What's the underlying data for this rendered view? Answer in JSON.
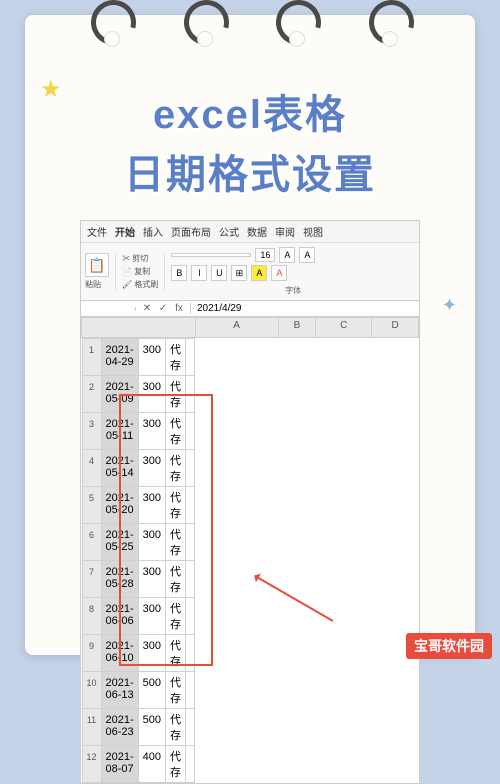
{
  "title": {
    "line1": "excel表格",
    "line2": "日期格式设置"
  },
  "menu": [
    "文件",
    "开始",
    "插入",
    "页面布局",
    "公式",
    "数据",
    "审阅",
    "视图"
  ],
  "ribbon": {
    "paste": "粘贴",
    "cut": "剪切",
    "copy": "复制",
    "brush": "格式刷",
    "font_label": "字体",
    "font_size": "16",
    "bold": "B",
    "italic": "I",
    "underline": "U"
  },
  "formula": {
    "ref": "",
    "fx": "fx",
    "value": "2021/4/29"
  },
  "columns": [
    "A",
    "B",
    "C",
    "D"
  ],
  "rows": [
    {
      "a": "2021-04-29",
      "b": "300",
      "c": "代存",
      "d": ""
    },
    {
      "a": "2021-05-09",
      "b": "300",
      "c": "代存",
      "d": ""
    },
    {
      "a": "2021-05-11",
      "b": "300",
      "c": "代存",
      "d": ""
    },
    {
      "a": "2021-05-14",
      "b": "300",
      "c": "代存",
      "d": ""
    },
    {
      "a": "2021-05-20",
      "b": "300",
      "c": "代存",
      "d": ""
    },
    {
      "a": "2021-05-25",
      "b": "300",
      "c": "代存",
      "d": ""
    },
    {
      "a": "2021-05-28",
      "b": "300",
      "c": "代存",
      "d": ""
    },
    {
      "a": "2021-06-06",
      "b": "300",
      "c": "代存",
      "d": ""
    },
    {
      "a": "2021-06-10",
      "b": "300",
      "c": "代存",
      "d": ""
    },
    {
      "a": "2021-06-13",
      "b": "500",
      "c": "代存",
      "d": ""
    },
    {
      "a": "2021-06-23",
      "b": "500",
      "c": "代存",
      "d": ""
    },
    {
      "a": "2021-08-07",
      "b": "400",
      "c": "代存",
      "d": ""
    }
  ],
  "watermark": "宝哥软件园"
}
